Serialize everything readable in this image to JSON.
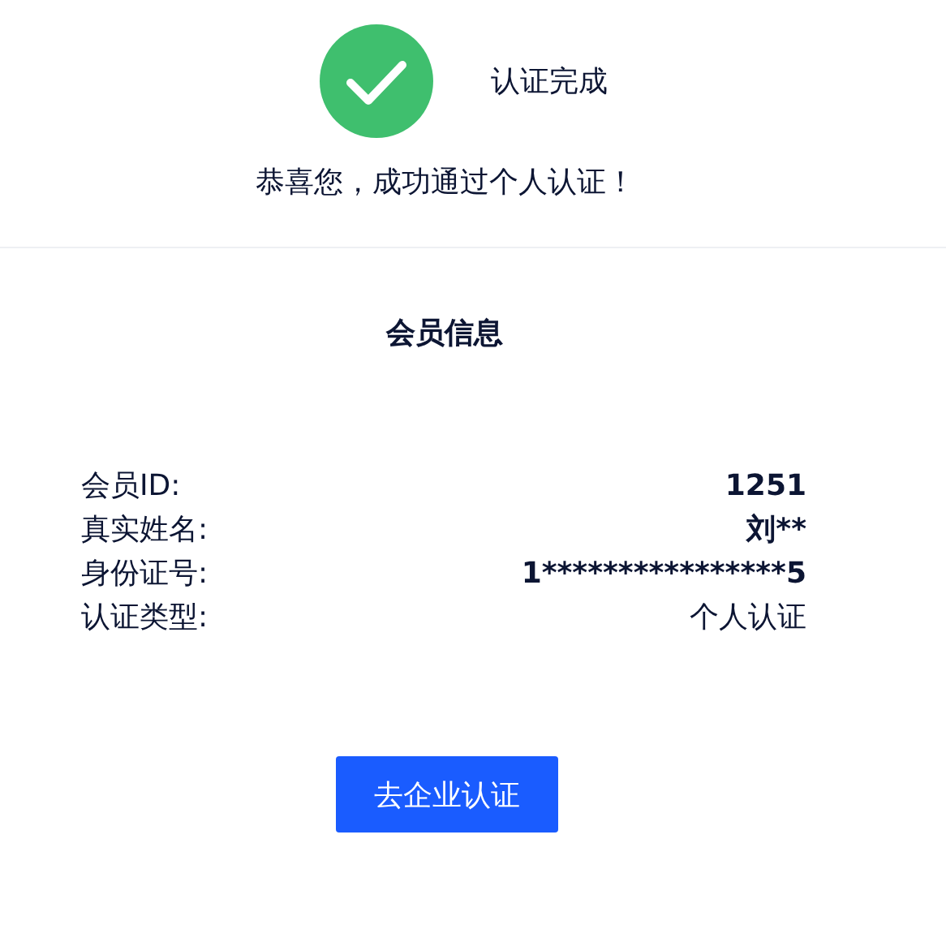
{
  "status": {
    "title": "认证完成",
    "message": "恭喜您，成功通过个人认证！"
  },
  "section_title": "会员信息",
  "rows": [
    {
      "label": "会员ID:",
      "value": "1251",
      "emphasis": true
    },
    {
      "label": "真实姓名:",
      "value": "刘**",
      "emphasis": true
    },
    {
      "label": "身份证号:",
      "value": "1****************5",
      "emphasis": true
    },
    {
      "label": "认证类型:",
      "value": "个人认证",
      "emphasis": false
    }
  ],
  "button": "去企业认证"
}
